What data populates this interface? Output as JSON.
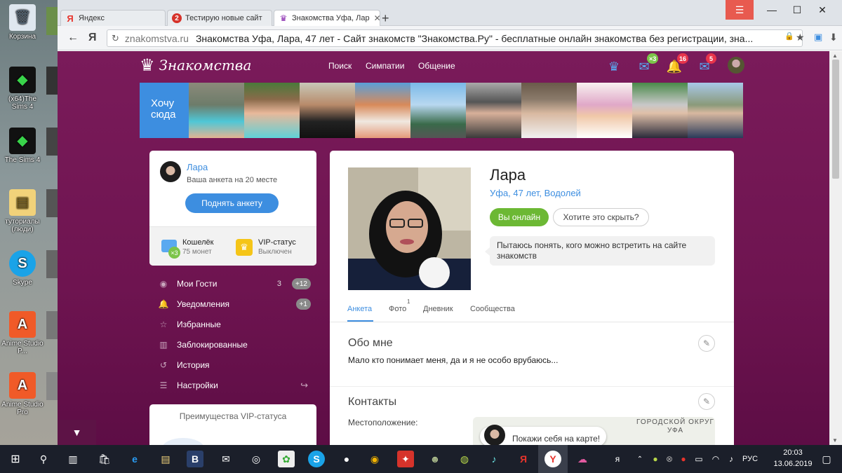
{
  "desktop": {
    "icons": [
      {
        "label": "Корзина",
        "icon": "recycle-bin-icon"
      },
      {
        "label": "(x64)The Sims 4",
        "icon": "sims4-icon"
      },
      {
        "label": "The Sims 4",
        "icon": "sims4-icon"
      },
      {
        "label": "туториалы (люди)",
        "icon": "folder-icon"
      },
      {
        "label": "Skype",
        "icon": "skype-icon"
      },
      {
        "label": "Anime Studio P...",
        "icon": "anime-studio-icon"
      },
      {
        "label": "Anime Studio Pro",
        "icon": "anime-studio-icon"
      }
    ]
  },
  "browser": {
    "tabs": [
      {
        "title": "Яндекс",
        "icon": "yandex-icon",
        "color": "#e8342c"
      },
      {
        "title": "Тестирую новые сайт",
        "icon": "site-icon",
        "color": "#d6332b"
      },
      {
        "title": "Знакомства Уфа, Лар",
        "icon": "znakomstva-icon",
        "color": "#8a2bb0"
      }
    ],
    "new_tab": "+",
    "menu_icon": "☰",
    "address": {
      "host": "znakomstva.ru",
      "title": "Знакомства Уфа, Лара, 47 лет - Сайт знакомств \"Знакомства.Ру\" - бесплатные онлайн знакомства без регистрации, зна..."
    }
  },
  "site": {
    "logo": "Знакомства",
    "nav": [
      "Поиск",
      "Симпатии",
      "Общение"
    ],
    "header_badges": {
      "chat": "×3",
      "notifications": "16",
      "messages": "5"
    },
    "want_here": "Хочу сюда",
    "profile_card": {
      "name": "Лара",
      "rank_prefix": "Ваша анкета на ",
      "rank_value": "20 месте",
      "raise_button": "Поднять анкету",
      "wallet_title": "Кошелёк",
      "wallet_sub": "75 монет",
      "wallet_badge": "×3",
      "vip_title": "VIP-статус",
      "vip_sub": "Выключен"
    },
    "menu": [
      {
        "label": "Мои Гости",
        "count": "3",
        "badge": "+12",
        "icon": "eye-icon"
      },
      {
        "label": "Уведомления",
        "count": "",
        "badge": "+1",
        "icon": "bell-icon"
      },
      {
        "label": "Избранные",
        "count": "",
        "badge": "",
        "icon": "star-icon"
      },
      {
        "label": "Заблокированные",
        "count": "",
        "badge": "",
        "icon": "trash-icon"
      },
      {
        "label": "История",
        "count": "",
        "badge": "",
        "icon": "history-icon"
      },
      {
        "label": "Настройки",
        "count": "",
        "badge": "",
        "icon": "settings-icon"
      }
    ],
    "vip_adv_title": "Преимущества VIP-статуса",
    "scroll_top": "▼",
    "profile": {
      "name": "Лара",
      "meta": "Уфа, 47 лет, Водолей",
      "online_button": "Вы онлайн",
      "hide_button": "Хотите это скрыть?",
      "status": "Пытаюсь понять, кого можно встретить на сайте знакомств",
      "tabs": [
        "Анкета",
        "Фото",
        "Дневник",
        "Сообщества"
      ],
      "photo_count": "1",
      "about_title": "Обо мне",
      "about_text": "Мало кто понимает меня, да и я не особо врубаюсь...",
      "contacts_title": "Контакты",
      "location_label": "Местоположение:",
      "map_district": "ГОРОДСКОЙ ОКРУГ УФА",
      "map_cta": "Покажи себя на карте!"
    }
  },
  "taskbar": {
    "lang": "РУС",
    "time": "20:03",
    "date": "13.06.2019"
  },
  "colors": {
    "page_bg": "#6e1450",
    "accent_blue": "#3d8ee0",
    "online_green": "#6cb834",
    "badge_red": "#e8344b"
  }
}
